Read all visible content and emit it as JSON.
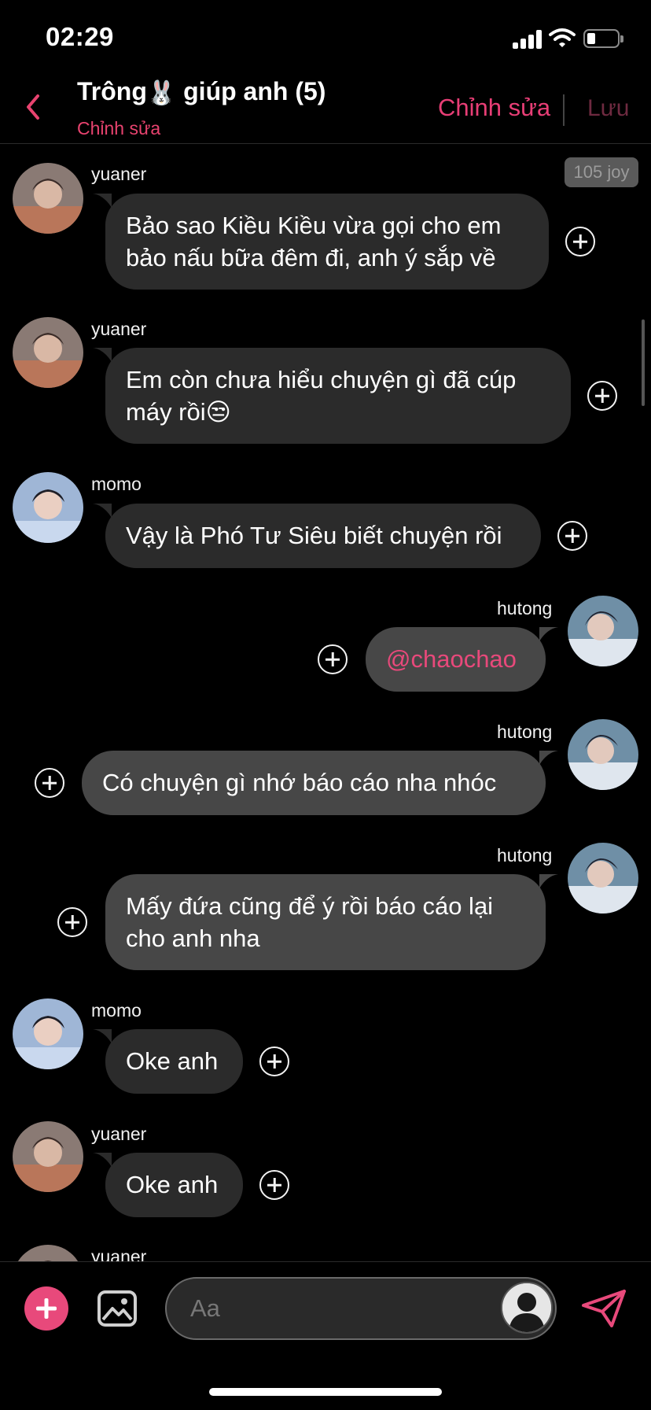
{
  "status_bar": {
    "time": "02:29"
  },
  "header": {
    "title_prefix": "Trông",
    "title_emoji": "🐰",
    "title_suffix": " giúp anh (5)",
    "subtitle": "Chỉnh sửa",
    "edit_label": "Chỉnh sửa",
    "save_label": "Lưu"
  },
  "badge": {
    "joy": "105 joy"
  },
  "messages": [
    {
      "sender": "yuaner",
      "text": "Bảo sao Kiều Kiều vừa gọi cho em bảo nấu bữa đêm đi, anh ý sắp về",
      "side": "left"
    },
    {
      "sender": "yuaner",
      "text": "Em còn chưa hiểu chuyện gì đã cúp máy rồi😒",
      "side": "left"
    },
    {
      "sender": "momo",
      "text": "Vậy là Phó Tư Siêu biết chuyện rồi",
      "side": "left"
    },
    {
      "sender": "hutong",
      "text": "@chaochao",
      "side": "right"
    },
    {
      "sender": "hutong",
      "text": "Có chuyện gì nhớ báo cáo nha nhóc",
      "side": "right"
    },
    {
      "sender": "hutong",
      "text": "Mấy đứa cũng để ý rồi báo cáo lại cho anh nha",
      "side": "right"
    },
    {
      "sender": "momo",
      "text": "Oke anh",
      "side": "left"
    },
    {
      "sender": "yuaner",
      "text": "Oke anh",
      "side": "left"
    },
    {
      "sender": "yuaner",
      "text": "",
      "side": "left"
    }
  ],
  "composer": {
    "placeholder": "Aa"
  },
  "colors": {
    "accent": "#e8497b",
    "bubble_in": "#2b2b2b",
    "bubble_out": "#474747",
    "background": "#000000"
  }
}
